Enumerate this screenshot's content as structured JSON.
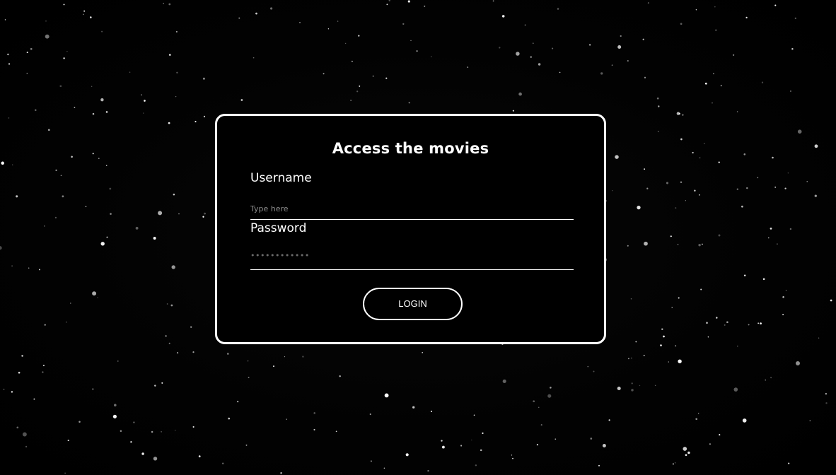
{
  "login": {
    "title": "Access the movies",
    "username_label": "Username",
    "username_placeholder": "Type here",
    "password_label": "Password",
    "password_placeholder": "••••••••••••",
    "button_label": "LOGIN"
  },
  "colors": {
    "background": "#000000",
    "foreground": "#ffffff",
    "placeholder": "#8a8a8a"
  }
}
